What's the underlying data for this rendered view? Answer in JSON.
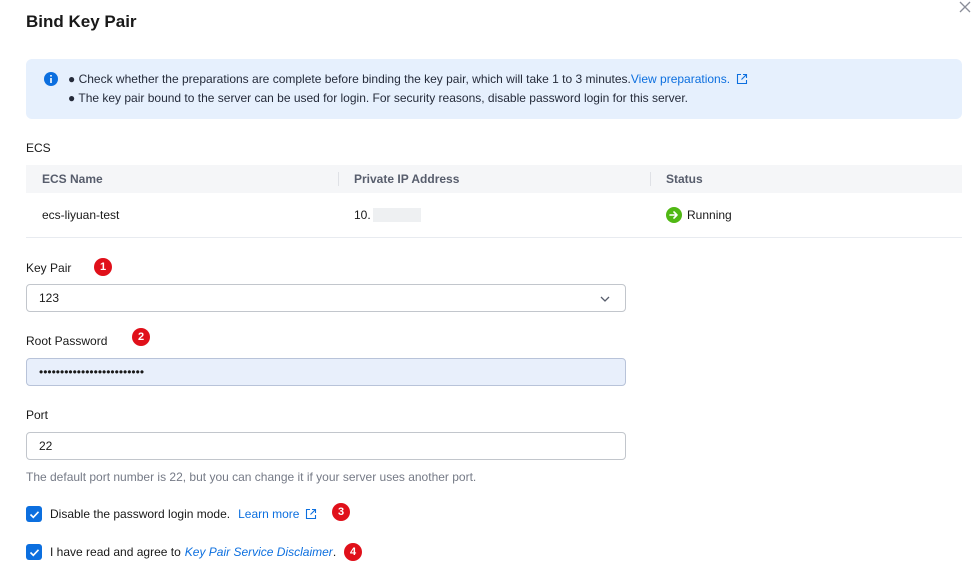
{
  "dialog": {
    "title": "Bind Key Pair"
  },
  "info": {
    "line1": "● Check whether the preparations are complete before binding the key pair, which will take 1 to 3 minutes.",
    "line1_link": "View preparations.",
    "line2": "● The key pair bound to the server can be used for login. For security reasons, disable password login for this server."
  },
  "ecs": {
    "section_label": "ECS",
    "columns": [
      "ECS Name",
      "Private IP Address",
      "Status"
    ],
    "rows": [
      {
        "name": "ecs-liyuan-test",
        "ip": "10.",
        "status": "Running"
      }
    ]
  },
  "key_pair": {
    "label": "Key Pair",
    "badge": "1",
    "value": "123"
  },
  "root_password": {
    "label": "Root Password",
    "badge": "2",
    "value": "•••••••••••••••••••••••••"
  },
  "port": {
    "label": "Port",
    "value": "22",
    "hint": "The default port number is 22, but you can change it if your server uses another port."
  },
  "disable_password": {
    "label": "Disable the password login mode.",
    "link": "Learn more",
    "badge": "3",
    "checked": true
  },
  "agreement": {
    "prefix": "I have read and agree to",
    "link": "Key Pair Service Disclaimer",
    "suffix": ".",
    "badge": "4",
    "checked": true
  },
  "colors": {
    "primary": "#0c6fdf",
    "info_bg": "#e6f0fd",
    "badge": "#e0101a",
    "running": "#50b814"
  }
}
